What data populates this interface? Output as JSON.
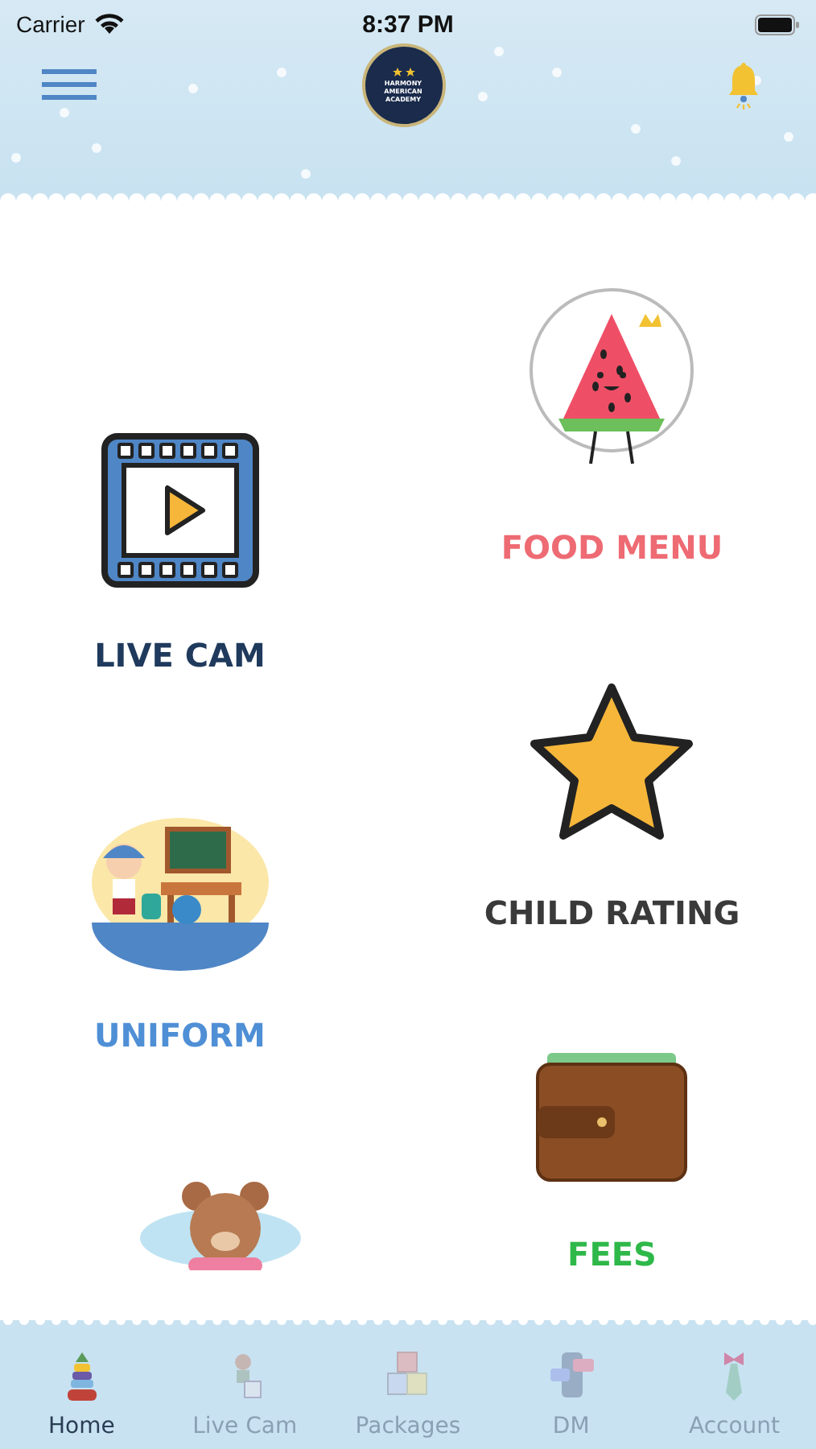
{
  "status_bar": {
    "carrier": "Carrier",
    "time": "8:37 PM"
  },
  "header": {
    "logo_text": "HARMONY AMERICAN ACADEMY"
  },
  "columns": [
    [
      {
        "kind": "video",
        "label": "LIVE CAM",
        "color": "#1f3a5c"
      },
      {
        "kind": "classroom",
        "label": "UNIFORM",
        "color": "#4f8fd6"
      },
      {
        "kind": "bear"
      }
    ],
    [
      {
        "kind": "watermelon",
        "label": "FOOD MENU",
        "color": "#ee6b73"
      },
      {
        "kind": "star",
        "label": "CHILD RATING",
        "color": "#3a3a3a"
      },
      {
        "kind": "wallet",
        "label": "FEES",
        "color": "#2fb84a"
      }
    ]
  ],
  "tabs": [
    {
      "kind": "tower",
      "label": "Home",
      "selected": true
    },
    {
      "kind": "toy",
      "label": "Live Cam",
      "selected": false
    },
    {
      "kind": "blocks",
      "label": "Packages",
      "selected": false
    },
    {
      "kind": "chat",
      "label": "DM",
      "selected": false
    },
    {
      "kind": "tie",
      "label": "Account",
      "selected": false
    }
  ]
}
